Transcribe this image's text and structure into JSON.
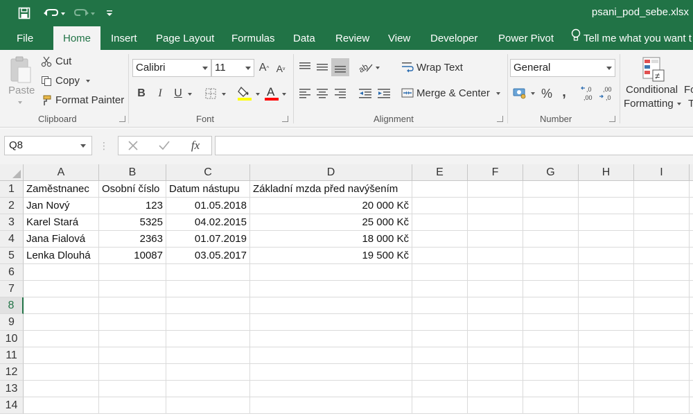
{
  "title_bar": {
    "document_title": "psani_pod_sebe.xlsx",
    "icons": [
      "save-icon",
      "undo-icon",
      "redo-icon",
      "customize-qat-icon"
    ]
  },
  "tabs": [
    "File",
    "Home",
    "Insert",
    "Page Layout",
    "Formulas",
    "Data",
    "Review",
    "View",
    "Developer",
    "Power Pivot"
  ],
  "active_tab": "Home",
  "tell_me": "Tell me what you want t",
  "ribbon": {
    "clipboard": {
      "paste": "Paste",
      "cut": "Cut",
      "copy": "Copy",
      "format_painter": "Format Painter",
      "label": "Clipboard"
    },
    "font": {
      "name": "Calibri",
      "size": "11",
      "bold": "B",
      "italic": "I",
      "underline": "U",
      "label": "Font"
    },
    "alignment": {
      "wrap_text": "Wrap Text",
      "merge_center": "Merge & Center",
      "label": "Alignment"
    },
    "number": {
      "format": "General",
      "percent": "%",
      "comma": ",",
      "label": "Number"
    },
    "styles": {
      "conditional_line1": "Conditional",
      "conditional_line2": "Formatting",
      "format_as_line1": "Fo",
      "format_as_line2": "T"
    }
  },
  "formula_bar": {
    "name_box": "Q8",
    "fx": "fx",
    "content": ""
  },
  "colors": {
    "brand": "#217346",
    "font_highlight": "#ffff00",
    "font_color": "#ff0000"
  },
  "grid": {
    "columns": [
      "A",
      "B",
      "C",
      "D",
      "E",
      "F",
      "G",
      "H",
      "I"
    ],
    "rows": [
      "1",
      "2",
      "3",
      "4",
      "5",
      "6",
      "7",
      "8",
      "9",
      "10",
      "11",
      "12",
      "13",
      "14"
    ],
    "selected_row": "8",
    "cells": [
      [
        "Zaměstnanec",
        "Osobní číslo",
        "Datum nástupu",
        "Základní mzda před navýšením"
      ],
      [
        "Jan Nový",
        "123",
        "01.05.2018",
        "20 000 Kč"
      ],
      [
        "Karel Stará",
        "5325",
        "04.02.2015",
        "25 000 Kč"
      ],
      [
        "Jana Fialová",
        "2363",
        "01.07.2019",
        "18 000 Kč"
      ],
      [
        "Lenka Dlouhá",
        "10087",
        "03.05.2017",
        "19 500 Kč"
      ]
    ]
  }
}
